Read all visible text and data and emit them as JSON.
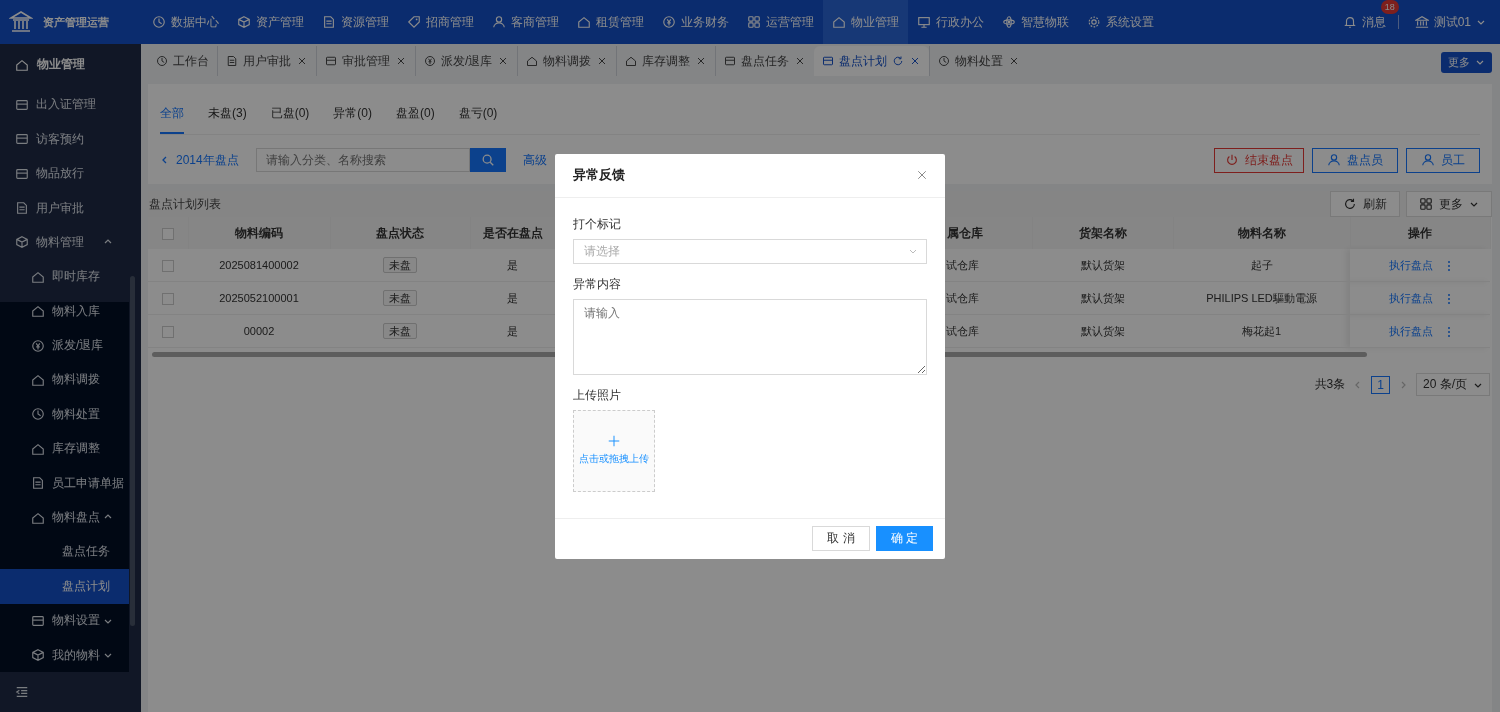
{
  "app": {
    "title": "资产管理运营"
  },
  "top_menu": [
    {
      "label": "数据中心",
      "selected": false
    },
    {
      "label": "资产管理",
      "selected": false
    },
    {
      "label": "资源管理",
      "selected": false
    },
    {
      "label": "招商管理",
      "selected": false
    },
    {
      "label": "客商管理",
      "selected": false
    },
    {
      "label": "租赁管理",
      "selected": false
    },
    {
      "label": "业务财务",
      "selected": false
    },
    {
      "label": "运营管理",
      "selected": false
    },
    {
      "label": "物业管理",
      "selected": true
    },
    {
      "label": "行政办公",
      "selected": false
    },
    {
      "label": "智慧物联",
      "selected": false
    },
    {
      "label": "系统设置",
      "selected": false
    }
  ],
  "header": {
    "messages": {
      "label": "消息",
      "badge": "18"
    },
    "user": "测试01"
  },
  "sidebar": {
    "title": "物业管理",
    "items": [
      {
        "label": "出入证管理",
        "selected": false
      },
      {
        "label": "访客预约",
        "selected": false
      },
      {
        "label": "物品放行",
        "selected": false
      },
      {
        "label": "用户审批",
        "selected": false
      },
      {
        "label": "物料管理",
        "selected": false,
        "expanded": true,
        "children": [
          {
            "label": "即时库存",
            "selected": false
          },
          {
            "label": "物料入库",
            "selected": false
          },
          {
            "label": "派发/退库",
            "selected": false
          },
          {
            "label": "物料调拨",
            "selected": false
          },
          {
            "label": "物料处置",
            "selected": false
          },
          {
            "label": "库存调整",
            "selected": false
          },
          {
            "label": "员工申请单据",
            "selected": false
          },
          {
            "label": "物料盘点",
            "selected": false,
            "expanded": true,
            "children": [
              {
                "label": "盘点任务",
                "selected": false
              },
              {
                "label": "盘点计划",
                "selected": true
              }
            ]
          },
          {
            "label": "物料设置",
            "selected": false,
            "expanded": false
          },
          {
            "label": "我的物料",
            "selected": false,
            "expanded": false
          }
        ]
      }
    ]
  },
  "tabs": [
    {
      "label": "工作台",
      "selected": false,
      "closable": false
    },
    {
      "label": "用户审批",
      "selected": false,
      "closable": true
    },
    {
      "label": "审批管理",
      "selected": false,
      "closable": true
    },
    {
      "label": "派发/退库",
      "selected": false,
      "closable": true
    },
    {
      "label": "物料调拨",
      "selected": false,
      "closable": true
    },
    {
      "label": "库存调整",
      "selected": false,
      "closable": true
    },
    {
      "label": "盘点任务",
      "selected": false,
      "closable": true
    },
    {
      "label": "盘点计划",
      "selected": true,
      "closable": true
    },
    {
      "label": "物料处置",
      "selected": false,
      "closable": true
    }
  ],
  "tabs_more": "更多",
  "filter_tabs": [
    {
      "label": "全部",
      "selected": true
    },
    {
      "label": "未盘(3)",
      "selected": false
    },
    {
      "label": "已盘(0)",
      "selected": false
    },
    {
      "label": "异常(0)",
      "selected": false
    },
    {
      "label": "盘盈(0)",
      "selected": false
    },
    {
      "label": "盘亏(0)",
      "selected": false
    }
  ],
  "toolbar": {
    "back": "2014年盘点",
    "search_placeholder": "请输入分类、名称搜索",
    "advanced_search": "高级",
    "actions": [
      {
        "label": "结束盘点",
        "kind": "danger"
      },
      {
        "label": "盘点员",
        "kind": "person"
      },
      {
        "label": "员工",
        "kind": "person"
      }
    ]
  },
  "table": {
    "title": "盘点计划列表",
    "all_checked": false,
    "refresh": "刷新",
    "more": "更多",
    "columns": [
      "物料编码",
      "盘点状态",
      "是否在盘点",
      "属仓库",
      "货架名称",
      "物料名称",
      "操作"
    ],
    "rows": [
      {
        "checked": false,
        "code": "2025081400002",
        "status": "未盘",
        "in_count": "是",
        "warehouse": "试仓库",
        "shelf": "默认货架",
        "name": "起子",
        "action": "执行盘点"
      },
      {
        "checked": false,
        "code": "2025052100001",
        "status": "未盘",
        "in_count": "是",
        "warehouse": "试仓库",
        "shelf": "默认货架",
        "name": "PHILIPS LED驅動電源",
        "action": "执行盘点"
      },
      {
        "checked": false,
        "code": "00002",
        "status": "未盘",
        "in_count": "是",
        "warehouse": "试仓库",
        "shelf": "默认货架",
        "name": "梅花起1",
        "action": "执行盘点"
      }
    ]
  },
  "pagination": {
    "total": "共3条",
    "page": "1",
    "page_size": "20 条/页"
  },
  "modal": {
    "title": "异常反馈",
    "fields": [
      {
        "kind": "select",
        "label": "打个标记",
        "placeholder": "请选择"
      },
      {
        "kind": "textarea",
        "label": "异常内容",
        "placeholder": "请输入"
      },
      {
        "kind": "upload",
        "label": "上传照片",
        "text": "点击或拖拽上传"
      }
    ],
    "buttons": [
      {
        "label": "取 消",
        "kind": "default"
      },
      {
        "label": "确 定",
        "kind": "primary"
      }
    ]
  }
}
